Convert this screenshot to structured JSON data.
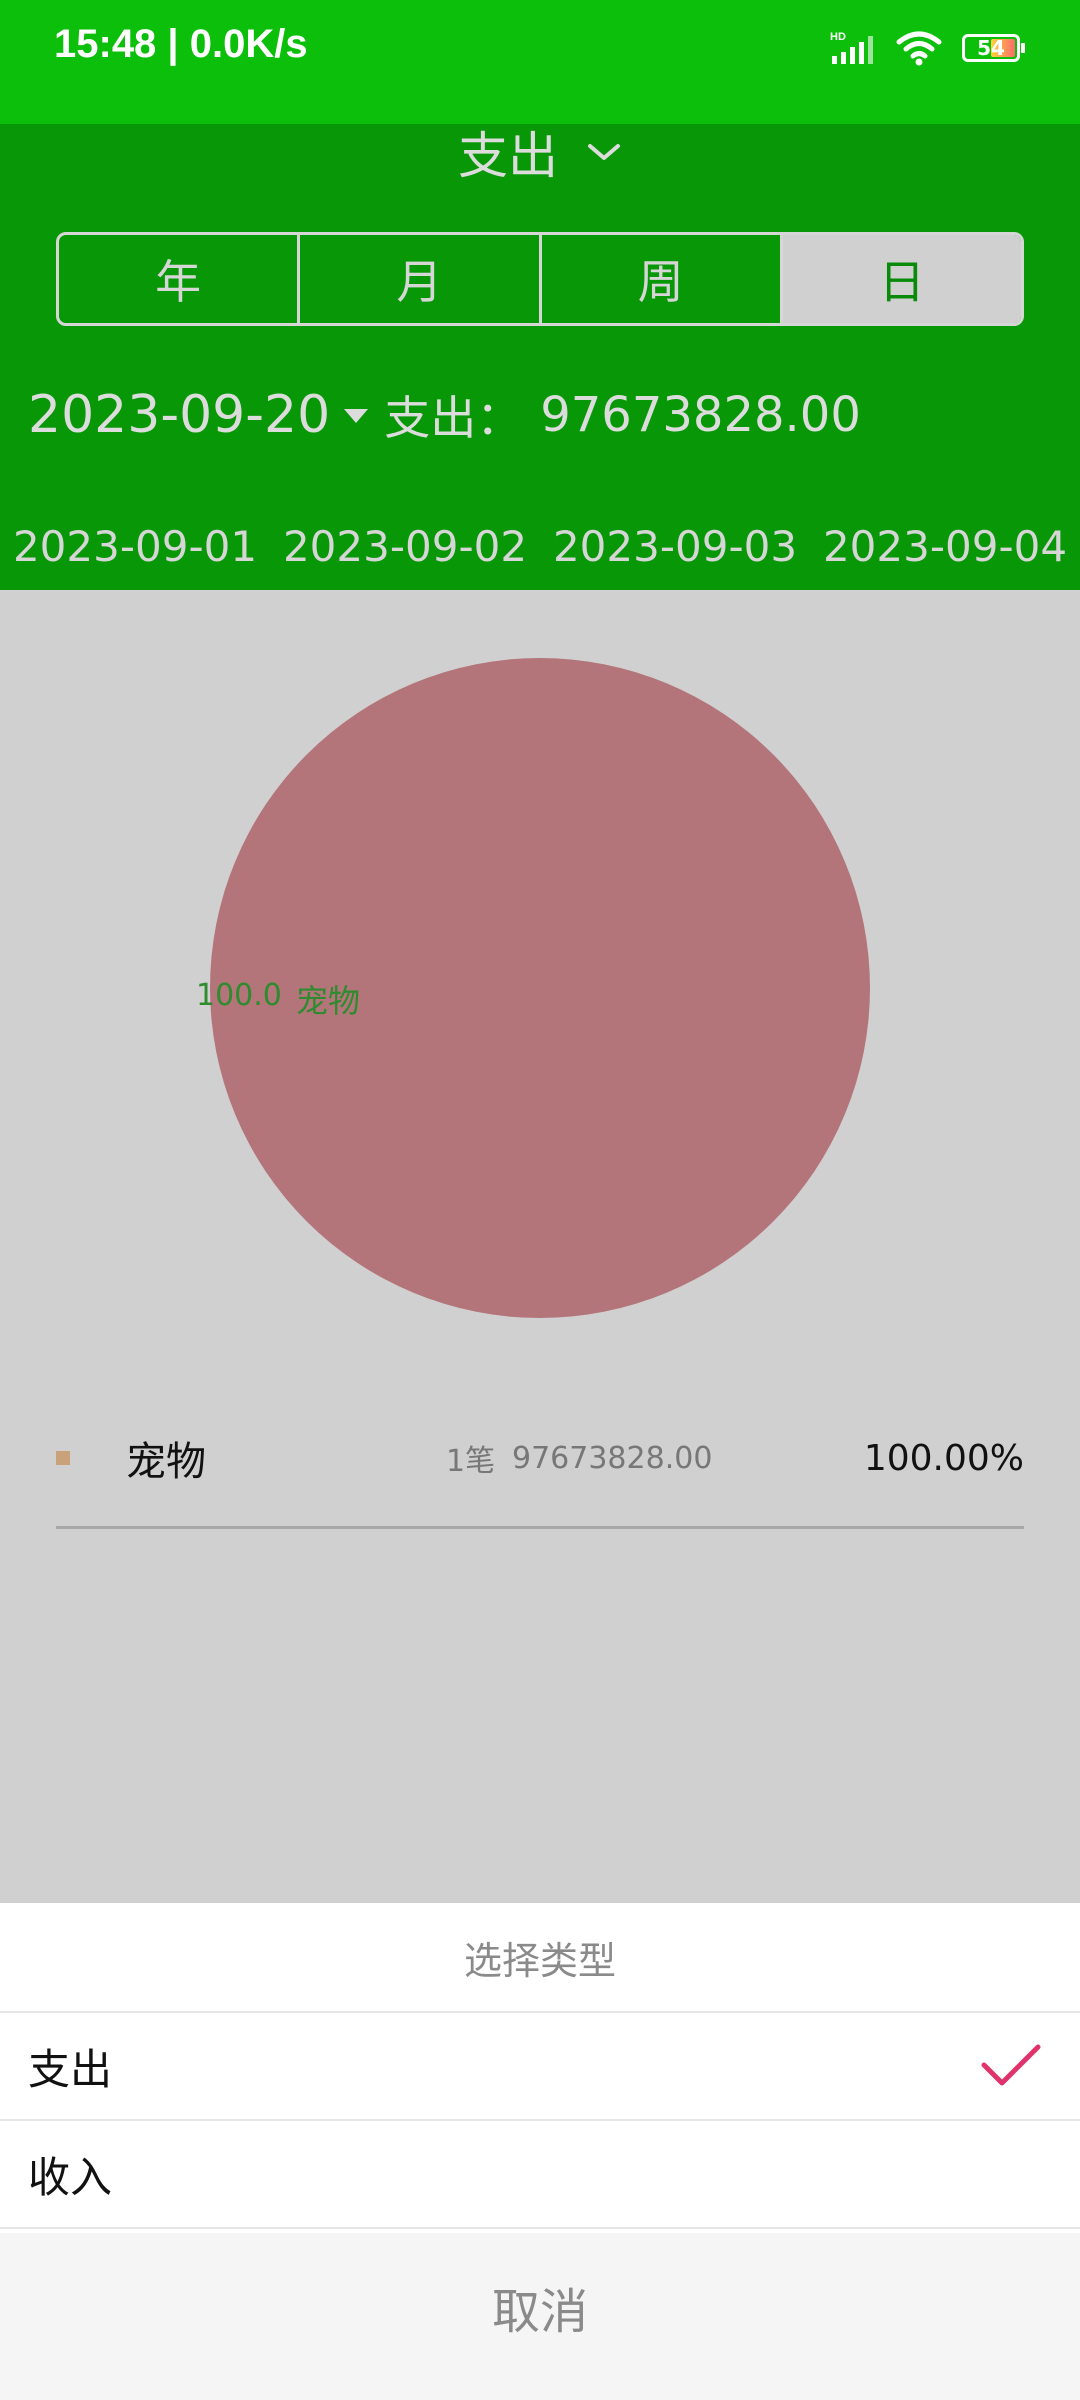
{
  "status_bar": {
    "time": "15:48 | 0.0K/s",
    "battery_level": "54"
  },
  "header": {
    "type_title": "支出",
    "segments": [
      {
        "label": "年"
      },
      {
        "label": "月"
      },
      {
        "label": "周"
      },
      {
        "label": "日"
      }
    ],
    "active_segment": "日",
    "current_date": "2023-09-20",
    "expense_label": "支出：",
    "expense_total": "97673828.00",
    "date_tabs": [
      "2023-09-01",
      "2023-09-02",
      "2023-09-03",
      "2023-09-04"
    ]
  },
  "chart_data": {
    "type": "pie",
    "slices": [
      {
        "name": "宠物",
        "value": 100.0,
        "color": "#b3747a"
      }
    ],
    "slice_label_value": "100.0",
    "slice_label_name": "宠物"
  },
  "legend": [
    {
      "name": "宠物",
      "count": "1笔",
      "amount": "97673828.00",
      "percent": "100.00%",
      "swatch_color": "#c9a27a"
    }
  ],
  "sheet": {
    "title": "选择类型",
    "options": [
      {
        "label": "支出",
        "selected": true
      },
      {
        "label": "收入",
        "selected": false
      }
    ],
    "cancel_label": "取消",
    "check_color": "#e0336b"
  },
  "colors": {
    "status_green": "#0bbf0b",
    "header_green": "#079707",
    "overlay_gray": "#d0d0d0"
  }
}
